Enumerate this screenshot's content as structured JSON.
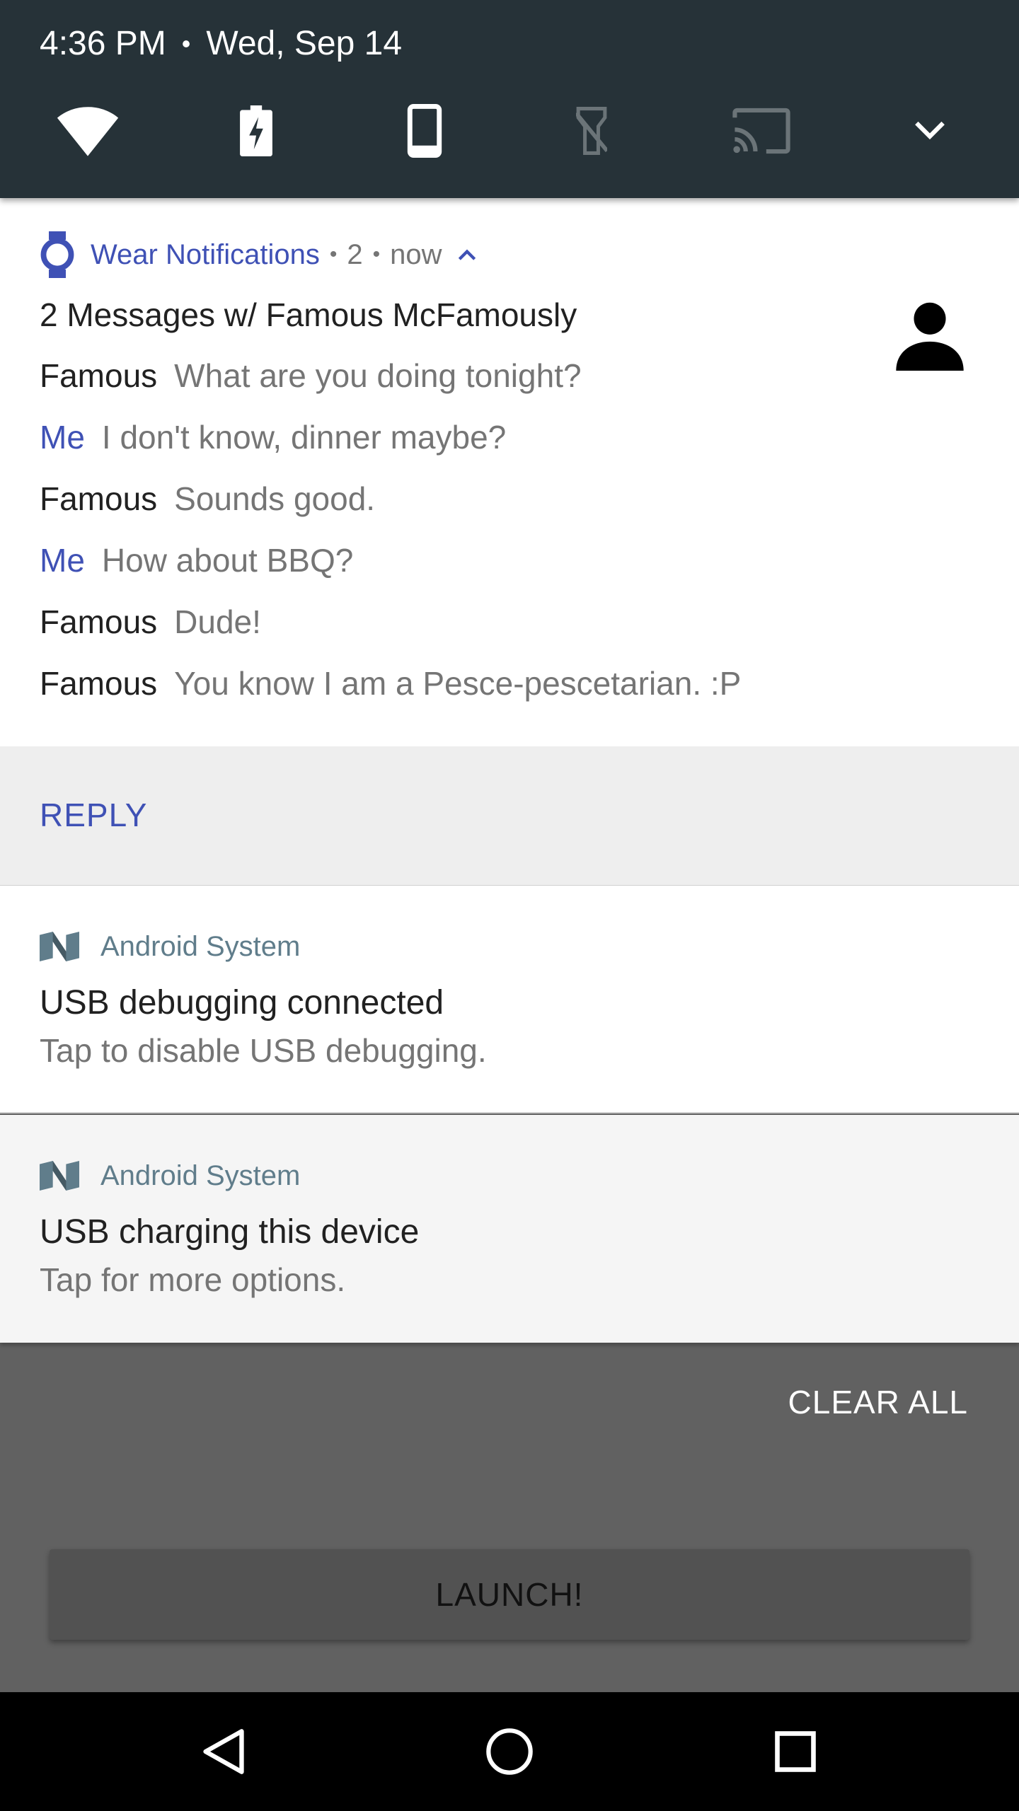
{
  "status": {
    "time": "4:36 PM",
    "separator": "•",
    "date": "Wed, Sep 14"
  },
  "quick_settings": {
    "tiles": [
      {
        "icon": "wifi-icon",
        "state": "on"
      },
      {
        "icon": "battery-saver-icon",
        "state": "on"
      },
      {
        "icon": "auto-rotate-icon",
        "state": "on"
      },
      {
        "icon": "flashlight-icon",
        "state": "off"
      },
      {
        "icon": "cast-icon",
        "state": "off"
      },
      {
        "icon": "chevron-down-icon",
        "state": "on"
      }
    ]
  },
  "wear_notification": {
    "app_name": "Wear Notifications",
    "dot": "•",
    "count": "2",
    "time": "now",
    "title": "2 Messages w/ Famous McFamously",
    "messages": [
      {
        "sender": "Famous",
        "text": "What are you doing tonight?",
        "is_me": false
      },
      {
        "sender": "Me",
        "text": "I don't know, dinner maybe?",
        "is_me": true
      },
      {
        "sender": "Famous",
        "text": "Sounds good.",
        "is_me": false
      },
      {
        "sender": "Me",
        "text": "How about BBQ?",
        "is_me": true
      },
      {
        "sender": "Famous",
        "text": "Dude!",
        "is_me": false
      },
      {
        "sender": "Famous",
        "text": "You know I am a Pesce-pescetarian. :P",
        "is_me": false
      }
    ],
    "action_label": "REPLY"
  },
  "system_notifications": [
    {
      "app_name": "Android System",
      "title": "USB debugging connected",
      "text": "Tap to disable USB debugging."
    },
    {
      "app_name": "Android System",
      "title": "USB charging this device",
      "text": "Tap for more options."
    }
  ],
  "clear_all_label": "CLEAR ALL",
  "launch_label": "LAUNCH!",
  "colors": {
    "accent": "#3f51b5",
    "header_bg": "#263238",
    "system_app": "#607d8b",
    "secondary_text": "#757575"
  }
}
